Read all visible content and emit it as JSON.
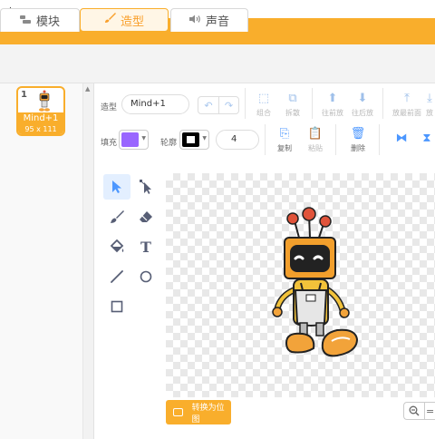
{
  "menu": {
    "marker": "."
  },
  "tabs": [
    {
      "icon": "code-blocks-icon",
      "label": "模块"
    },
    {
      "icon": "brush-icon",
      "label": "造型"
    },
    {
      "icon": "speaker-icon",
      "label": "声音"
    }
  ],
  "active_tab": "造型",
  "costume_list": [
    {
      "index": "1",
      "name": "Mind+1",
      "size": "95 x 111"
    }
  ],
  "toolbar": {
    "costume_label": "造型",
    "costume_name": "Mind+1",
    "fill_label": "填充",
    "fill_color": "#9966ff",
    "outline_label": "轮廓",
    "outline_color": "#000000",
    "outline_width": "4",
    "group_label": "组合",
    "ungroup_label": "拆散",
    "forward_label": "往前放",
    "backward_label": "往后放",
    "front_label": "放最前面",
    "back_label_partial": "放",
    "copy_label": "复制",
    "paste_label": "粘贴",
    "delete_label": "删除"
  },
  "tools": [
    "select",
    "reshape",
    "brush",
    "eraser",
    "fill",
    "text",
    "line",
    "circle",
    "rectangle"
  ],
  "convert_button": "转换为位图",
  "zoom": {
    "out": "−",
    "reset": "="
  },
  "colors": {
    "accent": "#f9ae2c",
    "highlight": "#4c97ff"
  }
}
